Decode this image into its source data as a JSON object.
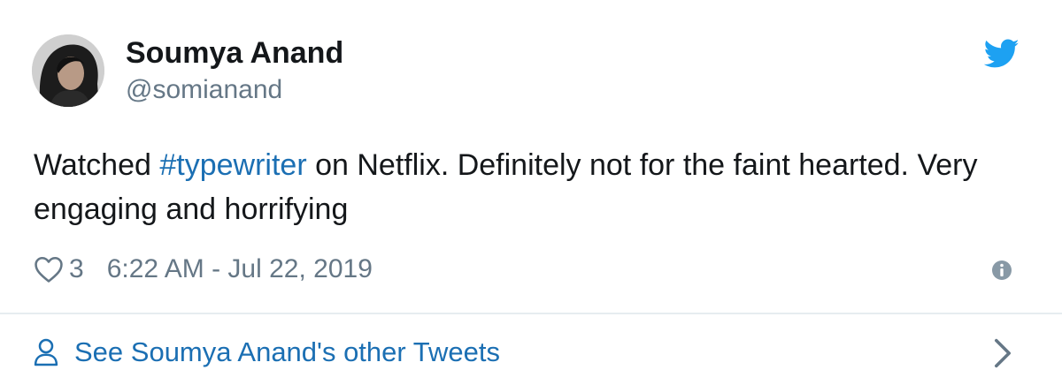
{
  "user": {
    "display_name": "Soumya Anand",
    "handle": "@somianand"
  },
  "tweet": {
    "text_before": "Watched ",
    "hashtag": "#typewriter",
    "text_after": " on Netflix. Definitely not for the faint hearted. Very engaging and horrifying"
  },
  "meta": {
    "like_count": "3",
    "timestamp": "6:22 AM - Jul 22, 2019"
  },
  "footer": {
    "link_label": "See Soumya Anand's other Tweets"
  },
  "icons": {
    "brand": "twitter-bird-icon",
    "like": "heart-icon",
    "info": "info-icon",
    "person": "person-icon",
    "chevron": "chevron-right-icon"
  },
  "colors": {
    "brand_blue": "#1da1f2",
    "link_blue": "#1b6fb3",
    "text_primary": "#14171a",
    "text_secondary": "#657786",
    "divider": "#e6ecf0"
  }
}
